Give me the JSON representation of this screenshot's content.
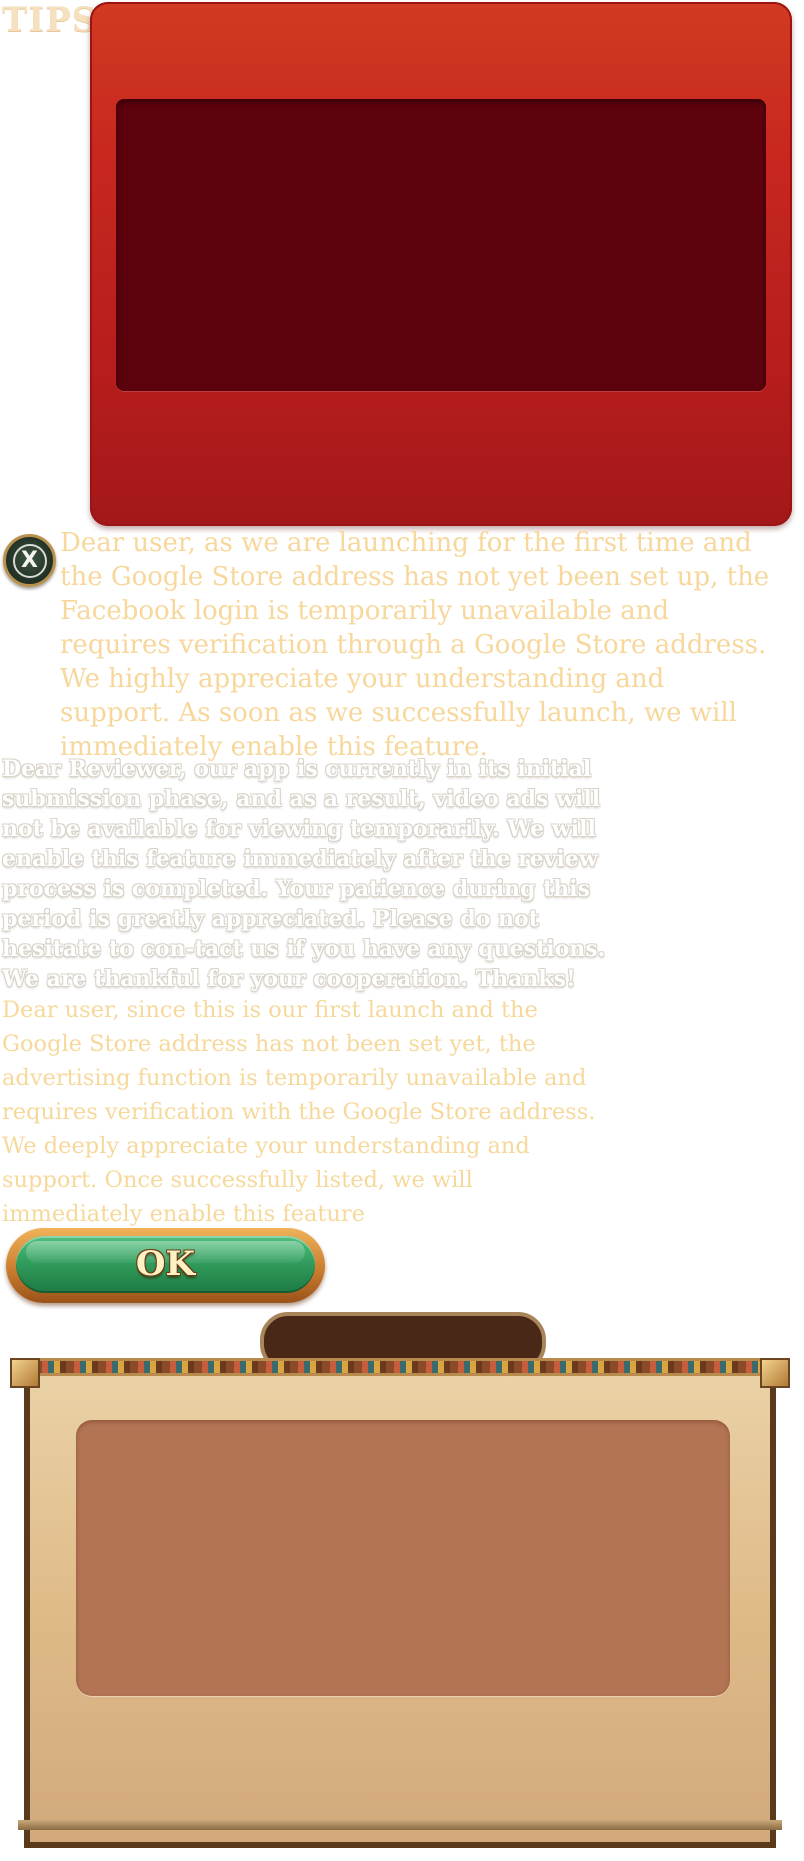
{
  "header": {
    "title": "TIPS"
  },
  "dialog": {
    "close_symbol": "X",
    "message_facebook": "Dear user, as we are launching for the first time and the Google Store address has not yet been set up, the Facebook login is temporarily unavailable and requires verification through a Google Store address. We highly appreciate your understanding and support. As soon as we successfully launch, we will immediately enable this feature.",
    "message_reviewer": "Dear Reviewer, our app is currently in its initial submission phase, and as a result, video ads will not be available for viewing temporarily. We will enable this feature immediately after the review process is completed. Your patience during this period is greatly appreciated. Please do not hesitate to con-tact us if you have any questions. We are thankful for your cooperation. Thanks!",
    "message_ads": "Dear user, since this is our first launch and the Google Store address has not been set yet, the advertising function is temporarily unavailable and requires verification with the Google Store address. We deeply appreciate your understanding and support. Once successfully listed, we will immediately enable this feature",
    "ok_label": "OK"
  },
  "icons": {
    "close": "close-icon"
  },
  "colors": {
    "tips_text": "#f5e0bf",
    "red_panel": "#c7271f",
    "red_panel_inner": "#5c020d",
    "gold_text": "#f7d79b",
    "ok_green": "#2f9a5a",
    "parchment": "#dfbb89",
    "parchment_window": "#b37453",
    "tab_brown": "#4a2818"
  }
}
